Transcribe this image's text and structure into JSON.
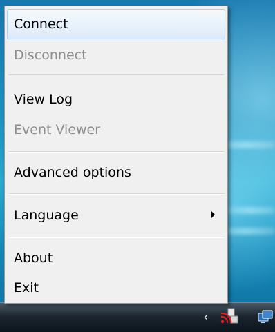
{
  "menu": {
    "items": [
      {
        "label": "Connect",
        "enabled": true,
        "highlighted": true
      },
      {
        "label": "Disconnect",
        "enabled": false
      },
      {
        "label": "View Log",
        "enabled": true
      },
      {
        "label": "Event Viewer",
        "enabled": false
      },
      {
        "label": "Advanced options",
        "enabled": true
      },
      {
        "label": "Language",
        "enabled": true,
        "has_submenu": true
      },
      {
        "label": "About",
        "enabled": true
      },
      {
        "label": "Exit",
        "enabled": true
      }
    ]
  },
  "taskbar": {
    "tray_icons": [
      "show-hidden-icons-arrow",
      "vpn-tray-icon",
      "network-icon"
    ]
  },
  "colors": {
    "menu_background": "#f0f0f0",
    "highlight_border": "#aecff0",
    "disabled_text": "#8d8d8d",
    "desktop": "#1a8fc0"
  }
}
